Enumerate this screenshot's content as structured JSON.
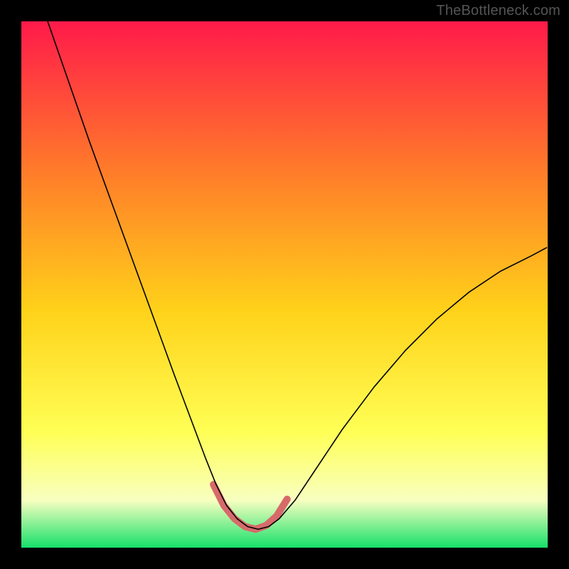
{
  "watermark": {
    "text": "TheBottleneck.com"
  },
  "colors": {
    "frame": "#000000",
    "gradient_top": "#ff1a4a",
    "gradient_mid_upper": "#ff7a2a",
    "gradient_mid": "#ffd21a",
    "gradient_mid_lower": "#ffff55",
    "gradient_lower": "#f8ffc0",
    "gradient_bottom": "#16e06a",
    "curve": "#000000",
    "highlight": "#d76a6a"
  },
  "chart_data": {
    "type": "line",
    "title": "",
    "xlabel": "",
    "ylabel": "",
    "xlim": [
      0,
      1
    ],
    "ylim": [
      0,
      1
    ],
    "note": "No numeric axes shown; x/y normalized to plot area. Lower y = better (green).",
    "series": [
      {
        "name": "main-curve",
        "x": [
          0.05,
          0.09,
          0.13,
          0.17,
          0.21,
          0.25,
          0.29,
          0.32,
          0.35,
          0.37,
          0.39,
          0.41,
          0.43,
          0.45,
          0.47,
          0.49,
          0.52,
          0.56,
          0.61,
          0.67,
          0.73,
          0.79,
          0.85,
          0.91,
          0.97,
          0.998
        ],
        "y": [
          1.0,
          0.885,
          0.77,
          0.66,
          0.55,
          0.44,
          0.33,
          0.25,
          0.17,
          0.12,
          0.08,
          0.055,
          0.04,
          0.035,
          0.04,
          0.055,
          0.09,
          0.15,
          0.225,
          0.305,
          0.375,
          0.435,
          0.485,
          0.525,
          0.555,
          0.57
        ]
      },
      {
        "name": "highlight-valley",
        "x": [
          0.365,
          0.385,
          0.405,
          0.425,
          0.445,
          0.465,
          0.485,
          0.505
        ],
        "y": [
          0.12,
          0.08,
          0.055,
          0.04,
          0.035,
          0.042,
          0.06,
          0.092
        ]
      }
    ]
  }
}
